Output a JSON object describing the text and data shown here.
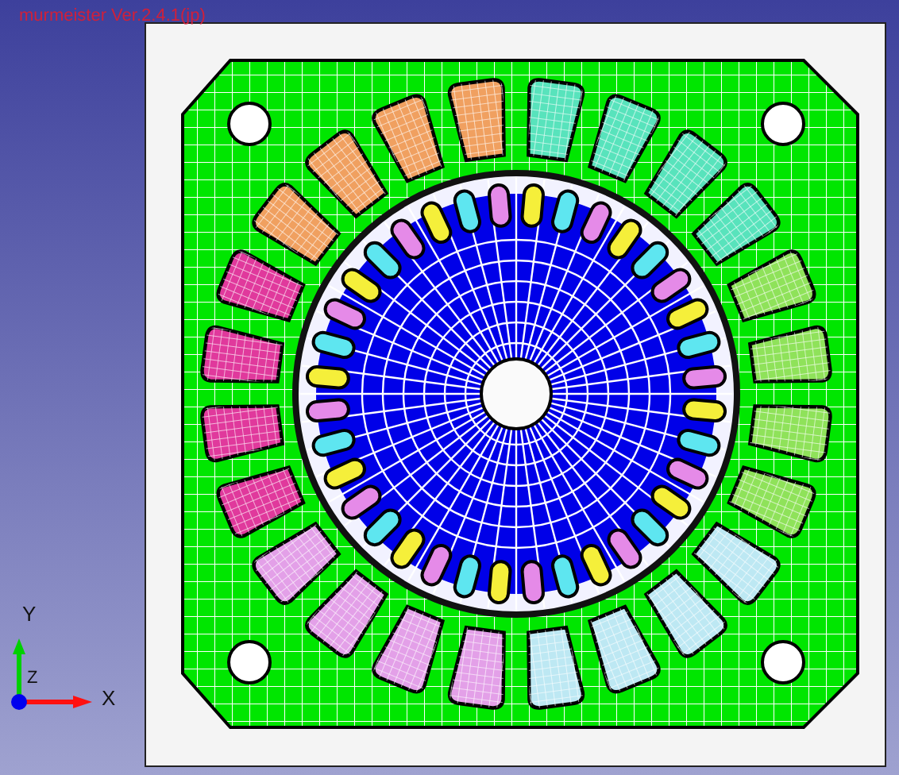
{
  "title": "murmeister Ver.2.4.1(jp)",
  "axes": {
    "y": "Y",
    "z": "Z",
    "x": "X"
  }
}
